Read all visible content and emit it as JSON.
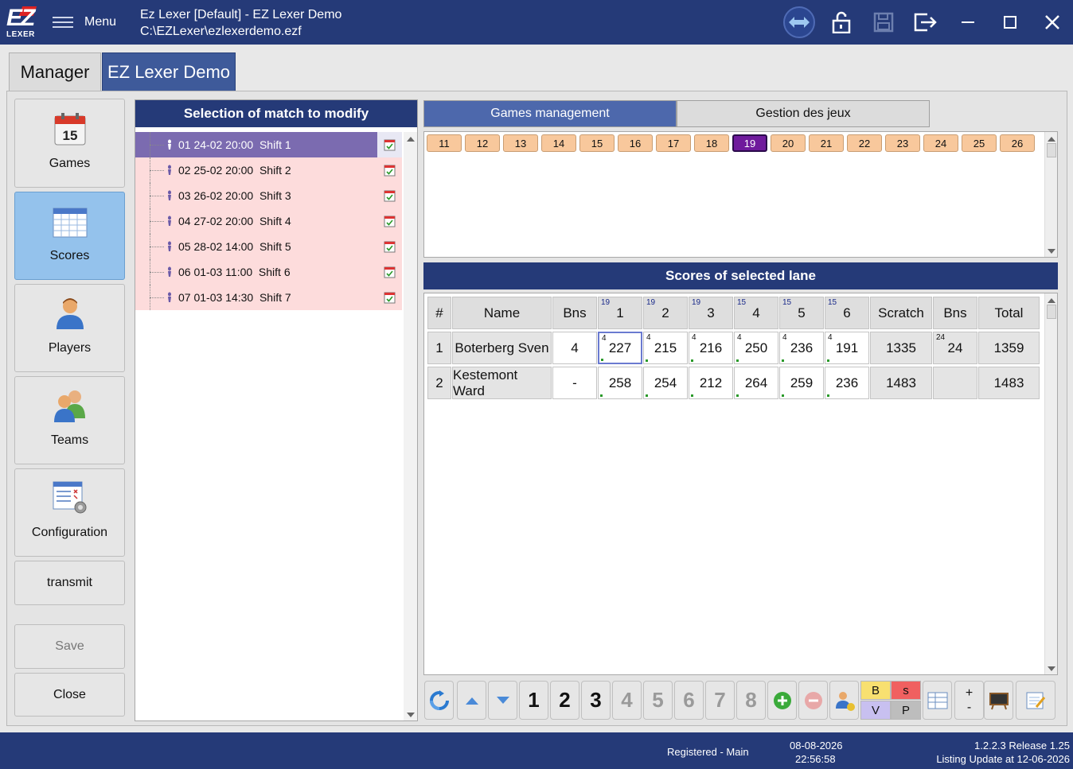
{
  "titlebar": {
    "logo_ez": "EZ",
    "logo_lexer": "LEXER",
    "menu_label": "Menu",
    "title_line1": "Ez Lexer [Default] - EZ Lexer Demo",
    "title_line2": "C:\\EZLexer\\ezlexerdemo.ezf",
    "icons": [
      "swap-arrows-icon",
      "unlock-icon",
      "save-disk-icon",
      "logout-icon",
      "minimize-icon",
      "maximize-icon",
      "close-icon"
    ]
  },
  "tabs": {
    "manager": "Manager",
    "demo": "EZ Lexer Demo"
  },
  "nav": {
    "games": "Games",
    "scores": "Scores",
    "players": "Players",
    "teams": "Teams",
    "configuration": "Configuration",
    "transmit": "transmit",
    "save": "Save",
    "close": "Close",
    "calendar_day": "15"
  },
  "match_panel": {
    "header": "Selection of match to modify",
    "matches": [
      {
        "no": "01",
        "date": "24-02 20:00",
        "shift": "Shift 1"
      },
      {
        "no": "02",
        "date": "25-02 20:00",
        "shift": "Shift 2"
      },
      {
        "no": "03",
        "date": "26-02 20:00",
        "shift": "Shift 3"
      },
      {
        "no": "04",
        "date": "27-02 20:00",
        "shift": "Shift 4"
      },
      {
        "no": "05",
        "date": "28-02 14:00",
        "shift": "Shift 5"
      },
      {
        "no": "06",
        "date": "01-03 11:00",
        "shift": "Shift 6"
      },
      {
        "no": "07",
        "date": "01-03 14:30",
        "shift": "Shift 7"
      }
    ],
    "selected_index": 0
  },
  "right_tabs": {
    "games_management": "Games management",
    "gestion": "Gestion des jeux"
  },
  "lanes": {
    "numbers": [
      "11",
      "12",
      "13",
      "14",
      "15",
      "16",
      "17",
      "18",
      "19",
      "20",
      "21",
      "22",
      "23",
      "24",
      "25",
      "26"
    ],
    "selected": "19"
  },
  "scores": {
    "header": "Scores of selected lane",
    "columns": [
      {
        "label": "#",
        "sup": ""
      },
      {
        "label": "Name",
        "sup": ""
      },
      {
        "label": "Bns",
        "sup": ""
      },
      {
        "label": "1",
        "sup": "19"
      },
      {
        "label": "2",
        "sup": "19"
      },
      {
        "label": "3",
        "sup": "19"
      },
      {
        "label": "4",
        "sup": "15"
      },
      {
        "label": "5",
        "sup": "15"
      },
      {
        "label": "6",
        "sup": "15"
      },
      {
        "label": "Scratch",
        "sup": ""
      },
      {
        "label": "Bns",
        "sup": ""
      },
      {
        "label": "Total",
        "sup": ""
      }
    ],
    "rows": [
      {
        "rank": "1",
        "name": "Boterberg Sven",
        "bonus": "4",
        "games": [
          "227",
          "215",
          "216",
          "250",
          "236",
          "191"
        ],
        "game_sup": [
          "4",
          "4",
          "4",
          "4",
          "4",
          "4"
        ],
        "scratch": "1335",
        "bns": "24",
        "bns_sup": "24",
        "total": "1359"
      },
      {
        "rank": "2",
        "name": "Kestemont Ward",
        "bonus": "-",
        "games": [
          "258",
          "254",
          "212",
          "264",
          "259",
          "236"
        ],
        "game_sup": [
          "",
          "",
          "",
          "",
          "",
          ""
        ],
        "scratch": "1483",
        "bns": "",
        "bns_sup": "",
        "total": "1483"
      }
    ]
  },
  "toolbar": {
    "game_numbers": [
      "1",
      "2",
      "3",
      "4",
      "5",
      "6",
      "7",
      "8"
    ],
    "active_game_count": 3,
    "b": "B",
    "s": "s",
    "v": "V",
    "p": "P",
    "plus": "+",
    "minus": "-"
  },
  "status": {
    "registered": "Registered - Main",
    "date": "08-08-2026",
    "time": "22:56:58",
    "release": "1.2.2.3 Release 1.25",
    "listing": "Listing Update at 12-06-2026"
  },
  "colors": {
    "brand": "#253a78",
    "match_bg": "#fddcdc",
    "selected": "#7b6bb0",
    "lane_chip": "#f8c89c",
    "lane_selected": "#6f1a9c"
  }
}
